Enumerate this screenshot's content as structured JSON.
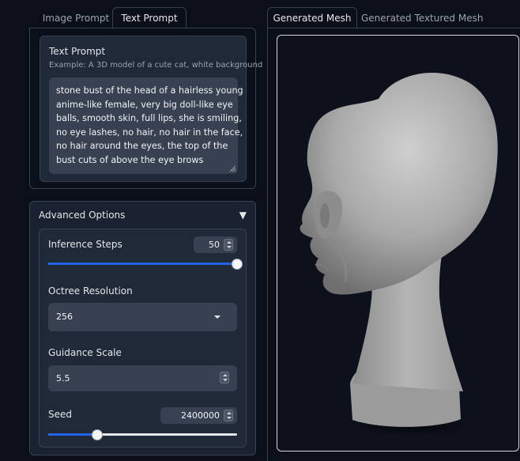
{
  "left_tabs": {
    "image_prompt": "Image Prompt",
    "text_prompt": "Text Prompt"
  },
  "text_prompt": {
    "label": "Text Prompt",
    "info": "Example: A 3D model of a cute cat, white background",
    "value_lines": [
      "stone bust of the head of a hairless young",
      "anime-like female, very big doll-like eye",
      "balls, smooth skin, full lips, she is smiling,",
      "no eye lashes, no hair, no hair in the face,",
      "no hair around the eyes, the top of the",
      "bust cuts of above the eye brows"
    ]
  },
  "advanced": {
    "title": "Advanced Options",
    "caret": "▼",
    "inference_steps": {
      "label": "Inference Steps",
      "value": "50",
      "fraction": 1.0
    },
    "octree_resolution": {
      "label": "Octree Resolution",
      "value": "256"
    },
    "guidance_scale": {
      "label": "Guidance Scale",
      "value": "5.5"
    },
    "seed": {
      "label": "Seed",
      "value": "2400000",
      "fraction": 0.26
    }
  },
  "right_tabs": {
    "generated_mesh": "Generated Mesh",
    "generated_textured_mesh": "Generated Textured Mesh"
  },
  "viewer": {
    "subject": "3D mesh render of a stone bust head in profile"
  },
  "colors": {
    "accent": "#2563eb",
    "background": "#0b0f19",
    "panel": "#1f2937",
    "input": "#374151"
  }
}
